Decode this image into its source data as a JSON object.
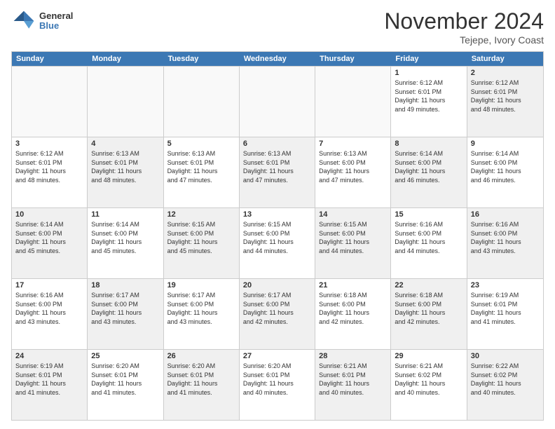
{
  "header": {
    "logo_line1": "General",
    "logo_line2": "Blue",
    "month": "November 2024",
    "location": "Tejepe, Ivory Coast"
  },
  "weekdays": [
    "Sunday",
    "Monday",
    "Tuesday",
    "Wednesday",
    "Thursday",
    "Friday",
    "Saturday"
  ],
  "rows": [
    [
      {
        "day": "",
        "info": "",
        "empty": true
      },
      {
        "day": "",
        "info": "",
        "empty": true
      },
      {
        "day": "",
        "info": "",
        "empty": true
      },
      {
        "day": "",
        "info": "",
        "empty": true
      },
      {
        "day": "",
        "info": "",
        "empty": true
      },
      {
        "day": "1",
        "info": "Sunrise: 6:12 AM\nSunset: 6:01 PM\nDaylight: 11 hours\nand 49 minutes.",
        "shaded": false
      },
      {
        "day": "2",
        "info": "Sunrise: 6:12 AM\nSunset: 6:01 PM\nDaylight: 11 hours\nand 48 minutes.",
        "shaded": true
      }
    ],
    [
      {
        "day": "3",
        "info": "Sunrise: 6:12 AM\nSunset: 6:01 PM\nDaylight: 11 hours\nand 48 minutes.",
        "shaded": false
      },
      {
        "day": "4",
        "info": "Sunrise: 6:13 AM\nSunset: 6:01 PM\nDaylight: 11 hours\nand 48 minutes.",
        "shaded": true
      },
      {
        "day": "5",
        "info": "Sunrise: 6:13 AM\nSunset: 6:01 PM\nDaylight: 11 hours\nand 47 minutes.",
        "shaded": false
      },
      {
        "day": "6",
        "info": "Sunrise: 6:13 AM\nSunset: 6:01 PM\nDaylight: 11 hours\nand 47 minutes.",
        "shaded": true
      },
      {
        "day": "7",
        "info": "Sunrise: 6:13 AM\nSunset: 6:00 PM\nDaylight: 11 hours\nand 47 minutes.",
        "shaded": false
      },
      {
        "day": "8",
        "info": "Sunrise: 6:14 AM\nSunset: 6:00 PM\nDaylight: 11 hours\nand 46 minutes.",
        "shaded": true
      },
      {
        "day": "9",
        "info": "Sunrise: 6:14 AM\nSunset: 6:00 PM\nDaylight: 11 hours\nand 46 minutes.",
        "shaded": false
      }
    ],
    [
      {
        "day": "10",
        "info": "Sunrise: 6:14 AM\nSunset: 6:00 PM\nDaylight: 11 hours\nand 45 minutes.",
        "shaded": true
      },
      {
        "day": "11",
        "info": "Sunrise: 6:14 AM\nSunset: 6:00 PM\nDaylight: 11 hours\nand 45 minutes.",
        "shaded": false
      },
      {
        "day": "12",
        "info": "Sunrise: 6:15 AM\nSunset: 6:00 PM\nDaylight: 11 hours\nand 45 minutes.",
        "shaded": true
      },
      {
        "day": "13",
        "info": "Sunrise: 6:15 AM\nSunset: 6:00 PM\nDaylight: 11 hours\nand 44 minutes.",
        "shaded": false
      },
      {
        "day": "14",
        "info": "Sunrise: 6:15 AM\nSunset: 6:00 PM\nDaylight: 11 hours\nand 44 minutes.",
        "shaded": true
      },
      {
        "day": "15",
        "info": "Sunrise: 6:16 AM\nSunset: 6:00 PM\nDaylight: 11 hours\nand 44 minutes.",
        "shaded": false
      },
      {
        "day": "16",
        "info": "Sunrise: 6:16 AM\nSunset: 6:00 PM\nDaylight: 11 hours\nand 43 minutes.",
        "shaded": true
      }
    ],
    [
      {
        "day": "17",
        "info": "Sunrise: 6:16 AM\nSunset: 6:00 PM\nDaylight: 11 hours\nand 43 minutes.",
        "shaded": false
      },
      {
        "day": "18",
        "info": "Sunrise: 6:17 AM\nSunset: 6:00 PM\nDaylight: 11 hours\nand 43 minutes.",
        "shaded": true
      },
      {
        "day": "19",
        "info": "Sunrise: 6:17 AM\nSunset: 6:00 PM\nDaylight: 11 hours\nand 43 minutes.",
        "shaded": false
      },
      {
        "day": "20",
        "info": "Sunrise: 6:17 AM\nSunset: 6:00 PM\nDaylight: 11 hours\nand 42 minutes.",
        "shaded": true
      },
      {
        "day": "21",
        "info": "Sunrise: 6:18 AM\nSunset: 6:00 PM\nDaylight: 11 hours\nand 42 minutes.",
        "shaded": false
      },
      {
        "day": "22",
        "info": "Sunrise: 6:18 AM\nSunset: 6:00 PM\nDaylight: 11 hours\nand 42 minutes.",
        "shaded": true
      },
      {
        "day": "23",
        "info": "Sunrise: 6:19 AM\nSunset: 6:01 PM\nDaylight: 11 hours\nand 41 minutes.",
        "shaded": false
      }
    ],
    [
      {
        "day": "24",
        "info": "Sunrise: 6:19 AM\nSunset: 6:01 PM\nDaylight: 11 hours\nand 41 minutes.",
        "shaded": true
      },
      {
        "day": "25",
        "info": "Sunrise: 6:20 AM\nSunset: 6:01 PM\nDaylight: 11 hours\nand 41 minutes.",
        "shaded": false
      },
      {
        "day": "26",
        "info": "Sunrise: 6:20 AM\nSunset: 6:01 PM\nDaylight: 11 hours\nand 41 minutes.",
        "shaded": true
      },
      {
        "day": "27",
        "info": "Sunrise: 6:20 AM\nSunset: 6:01 PM\nDaylight: 11 hours\nand 40 minutes.",
        "shaded": false
      },
      {
        "day": "28",
        "info": "Sunrise: 6:21 AM\nSunset: 6:01 PM\nDaylight: 11 hours\nand 40 minutes.",
        "shaded": true
      },
      {
        "day": "29",
        "info": "Sunrise: 6:21 AM\nSunset: 6:02 PM\nDaylight: 11 hours\nand 40 minutes.",
        "shaded": false
      },
      {
        "day": "30",
        "info": "Sunrise: 6:22 AM\nSunset: 6:02 PM\nDaylight: 11 hours\nand 40 minutes.",
        "shaded": true
      }
    ]
  ]
}
